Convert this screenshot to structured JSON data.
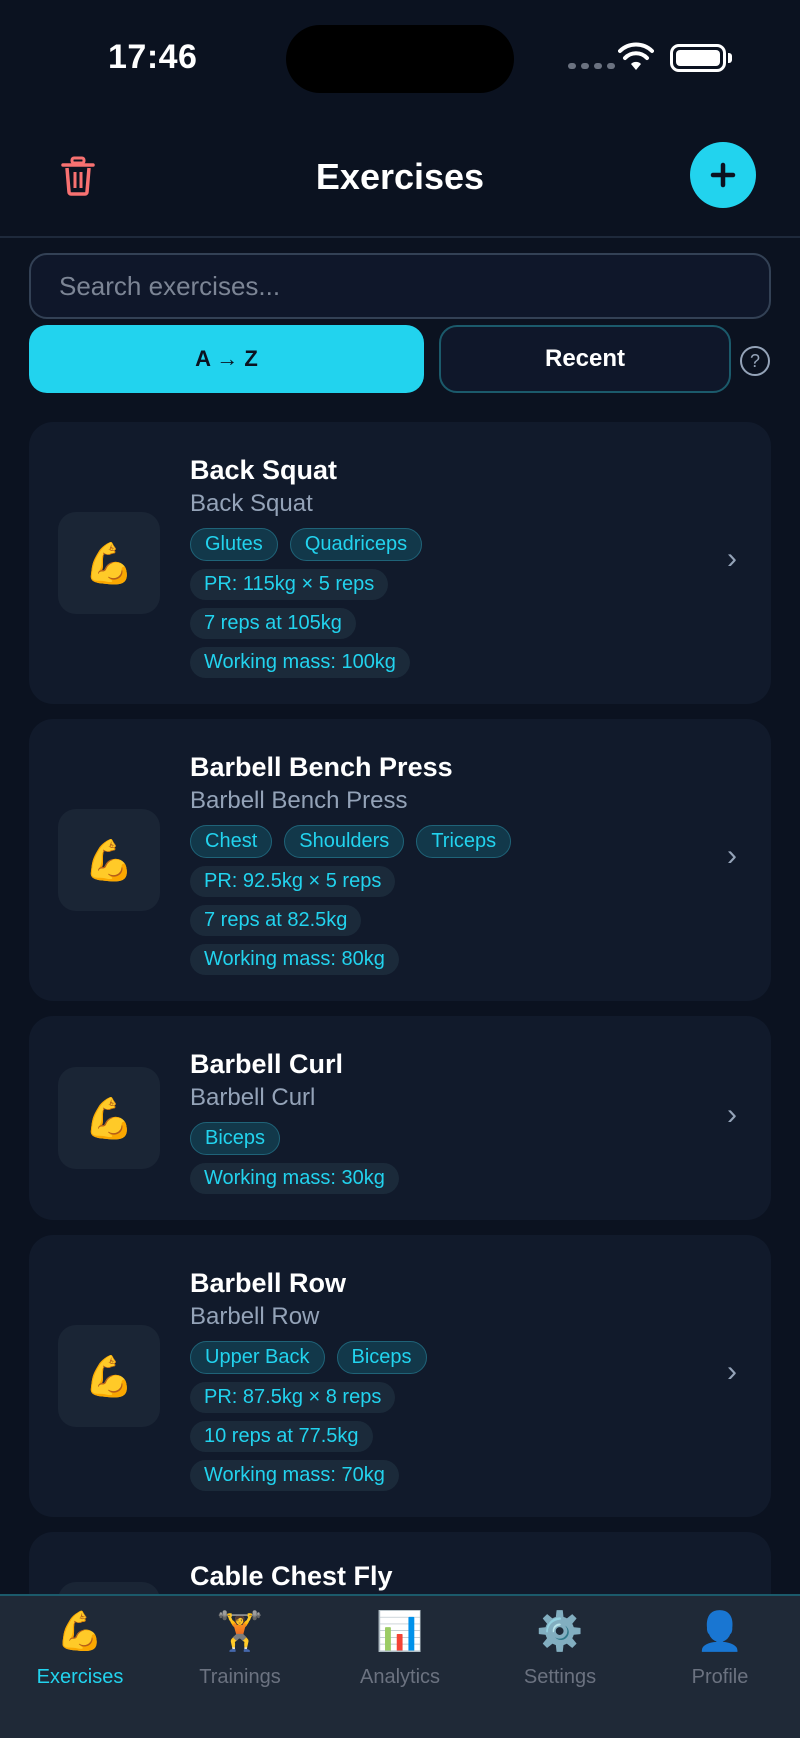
{
  "status_bar": {
    "time": "17:46"
  },
  "header": {
    "title": "Exercises"
  },
  "search": {
    "placeholder": "Search exercises..."
  },
  "sort": {
    "az_label": "A → Z",
    "recent_label": "Recent",
    "help_label": "?"
  },
  "exercises": [
    {
      "name": "Back Squat",
      "subtitle": "Back Squat",
      "muscles": [
        "Glutes",
        "Quadriceps"
      ],
      "stats": [
        "PR: 115kg × 5 reps",
        "7 reps at 105kg",
        "Working mass: 100kg"
      ]
    },
    {
      "name": "Barbell Bench Press",
      "subtitle": "Barbell Bench Press",
      "muscles": [
        "Chest",
        "Shoulders",
        "Triceps"
      ],
      "stats": [
        "PR: 92.5kg × 5 reps",
        "7 reps at 82.5kg",
        "Working mass: 80kg"
      ]
    },
    {
      "name": "Barbell Curl",
      "subtitle": "Barbell Curl",
      "muscles": [
        "Biceps"
      ],
      "stats": [
        "Working mass: 30kg"
      ]
    },
    {
      "name": "Barbell Row",
      "subtitle": "Barbell Row",
      "muscles": [
        "Upper Back",
        "Biceps"
      ],
      "stats": [
        "PR: 87.5kg × 8 reps",
        "10 reps at 77.5kg",
        "Working mass: 70kg"
      ]
    },
    {
      "name": "Cable Chest Fly",
      "subtitle": "",
      "muscles": [],
      "stats": []
    }
  ],
  "icons": {
    "exercise": "💪",
    "chevron": "›"
  },
  "tabs": [
    {
      "label": "Exercises",
      "icon": "💪",
      "active": true
    },
    {
      "label": "Trainings",
      "icon": "🏋️",
      "active": false
    },
    {
      "label": "Analytics",
      "icon": "📊",
      "active": false
    },
    {
      "label": "Settings",
      "icon": "⚙️",
      "active": false
    },
    {
      "label": "Profile",
      "icon": "👤",
      "active": false
    }
  ],
  "colors": {
    "accent": "#22d3ee",
    "background": "#0b1220",
    "card": "#111a2b",
    "danger": "#f87171"
  }
}
